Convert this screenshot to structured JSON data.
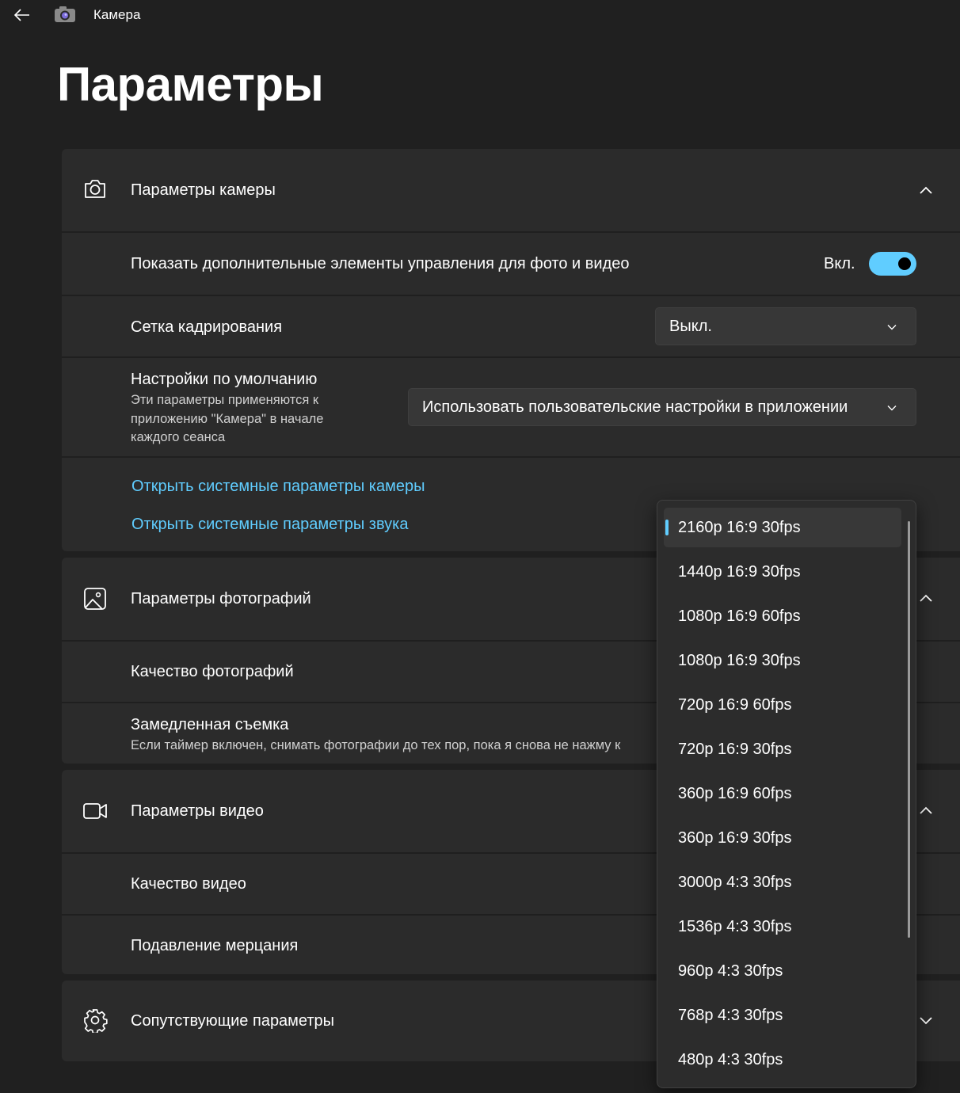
{
  "titlebar": {
    "app_title": "Камера",
    "back_icon": "arrow-left-icon",
    "app_icon": "camera-app-icon"
  },
  "page": {
    "title": "Параметры"
  },
  "camera_section": {
    "title": "Параметры камеры",
    "icon": "camera-icon",
    "expanded": true,
    "extra_controls": {
      "title": "Показать дополнительные элементы управления для фото и видео",
      "state_label": "Вкл.",
      "on": true
    },
    "framing_grid": {
      "title": "Сетка кадрирования",
      "value": "Выкл."
    },
    "defaults": {
      "title": "Настройки по умолчанию",
      "description_lines": [
        "Эти параметры применяются к",
        "приложению \"Камера\" в начале",
        "каждого сеанса"
      ],
      "value": "Использовать пользовательские настройки в приложении"
    },
    "links": {
      "camera_settings": "Открыть системные параметры камеры",
      "sound_settings": "Открыть системные параметры звука"
    }
  },
  "photo_section": {
    "title": "Параметры фотографий",
    "icon": "image-icon",
    "expanded": true,
    "quality_title": "Качество фотографий",
    "slowmo_title": "Замедленная съемка",
    "slowmo_desc": "Если таймер включен, снимать фотографии до тех пор, пока я снова не нажму к"
  },
  "video_section": {
    "title": "Параметры видео",
    "icon": "video-camera-icon",
    "expanded": true,
    "quality_title": "Качество видео",
    "flicker_title": "Подавление мерцания"
  },
  "related_section": {
    "title": "Сопутствующие параметры",
    "icon": "gear-icon",
    "expanded": false
  },
  "dropdown": {
    "selected_index": 0,
    "options": [
      "2160p 16:9 30fps",
      "1440p 16:9 30fps",
      "1080p 16:9 60fps",
      "1080p 16:9 30fps",
      "720p 16:9 60fps",
      "720p 16:9 30fps",
      "360p 16:9 60fps",
      "360p 16:9 30fps",
      "3000p 4:3 30fps",
      "1536p 4:3 30fps",
      "960p 4:3 30fps",
      "768p 4:3 30fps",
      "480p 4:3 30fps"
    ]
  },
  "colors": {
    "background": "#202020",
    "card": "#2b2b2b",
    "accent": "#60cdff",
    "text": "#ffffff"
  }
}
